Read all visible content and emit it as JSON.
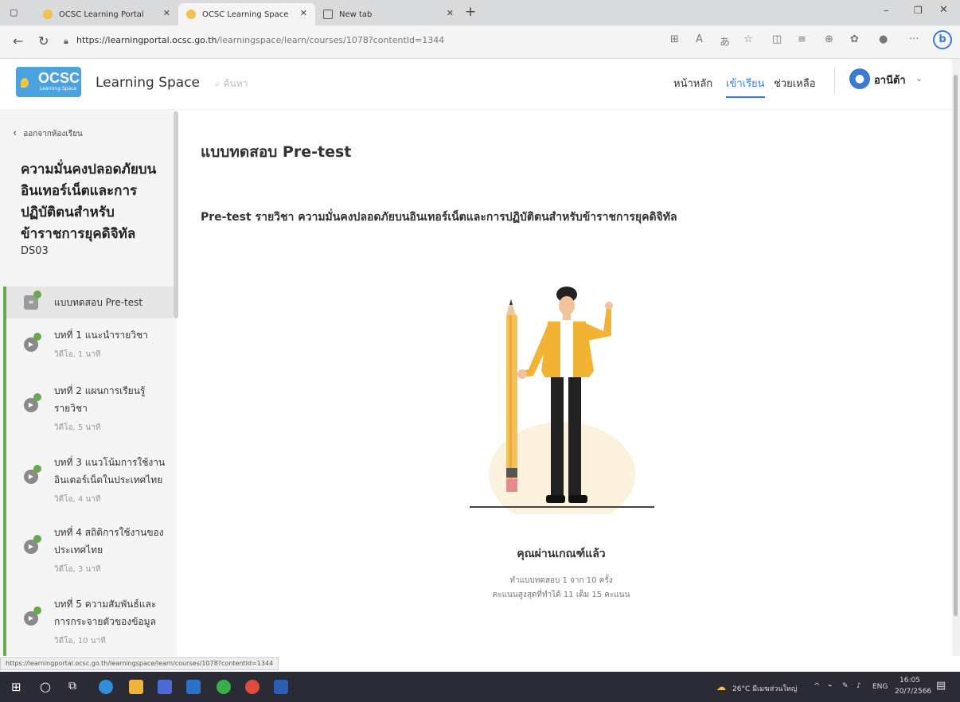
{
  "browser": {
    "tabs": [
      {
        "label": "OCSC Learning Portal"
      },
      {
        "label": "OCSC Learning Space"
      },
      {
        "label": "New tab"
      }
    ],
    "url_host": "https://learningportal.ocsc.go.th",
    "url_path": "/learningspace/learn/courses/1078?contentId=1344",
    "status_url": "https://learningportal.ocsc.go.th/learningspace/learn/courses/1078?contentId=1344"
  },
  "header": {
    "logo_text": "OCSC",
    "logo_sub": "Learning Space",
    "brand": "Learning Space",
    "search_placeholder": "ค้นหา",
    "nav": [
      {
        "label": "หน้าหลัก"
      },
      {
        "label": "เข้าเรียน"
      },
      {
        "label": "ช่วยเหลือ"
      }
    ],
    "user_name": "อานีต้า"
  },
  "sidebar": {
    "back_label": "ออกจากห้องเรียน",
    "course_title": "ความมั่นคงปลอดภัยบนอินเทอร์เน็ตและการปฏิบัติตนสำหรับข้าราชการยุคดิจิทัล",
    "course_code": "DS03",
    "lessons": [
      {
        "title": "แบบทดสอบ Pre-test",
        "meta": ""
      },
      {
        "title": "บทที่ 1 แนะนำรายวิชา",
        "meta": "วิดีโอ, 1 นาที"
      },
      {
        "title": "บทที่ 2 แผนการเรียนรู้รายวิชา",
        "meta": "วิดีโอ, 5 นาที"
      },
      {
        "title": "บทที่ 3 แนวโน้มการใช้งานอินเตอร์เน็ตในประเทศไทย",
        "meta": "วิดีโอ, 4 นาที"
      },
      {
        "title": "บทที่ 4 สถิติการใช้งานของประเทศไทย",
        "meta": "วิดีโอ, 3 นาที"
      },
      {
        "title": "บทที่ 5 ความสัมพันธ์และการกระจายตัวของข้อมูล",
        "meta": "วิดีโอ, 10 นาที"
      }
    ]
  },
  "main": {
    "page_title": "แบบทดสอบ Pre-test",
    "quiz_title": "Pre-test รายวิชา ความมั่นคงปลอดภัยบนอินเทอร์เน็ตและการปฏิบัติตนสำหรับข้าราชการยุคดิจิทัล",
    "result": "คุณผ่านเกณฑ์แล้ว",
    "attempts": "ทำแบบทดสอบ 1 จาก 10 ครั้ง",
    "score": "คะแนนสูงสุดที่ทำได้ 11 เต็ม 15 คะแนน"
  },
  "taskbar": {
    "weather": "26°C มีเมฆส่วนใหญ่",
    "lang": "ENG",
    "time": "16:05",
    "date": "20/7/2566"
  },
  "colors": {
    "accent": "#3a7bd5",
    "success": "#6aa84f",
    "logo": "#4aa3df"
  }
}
